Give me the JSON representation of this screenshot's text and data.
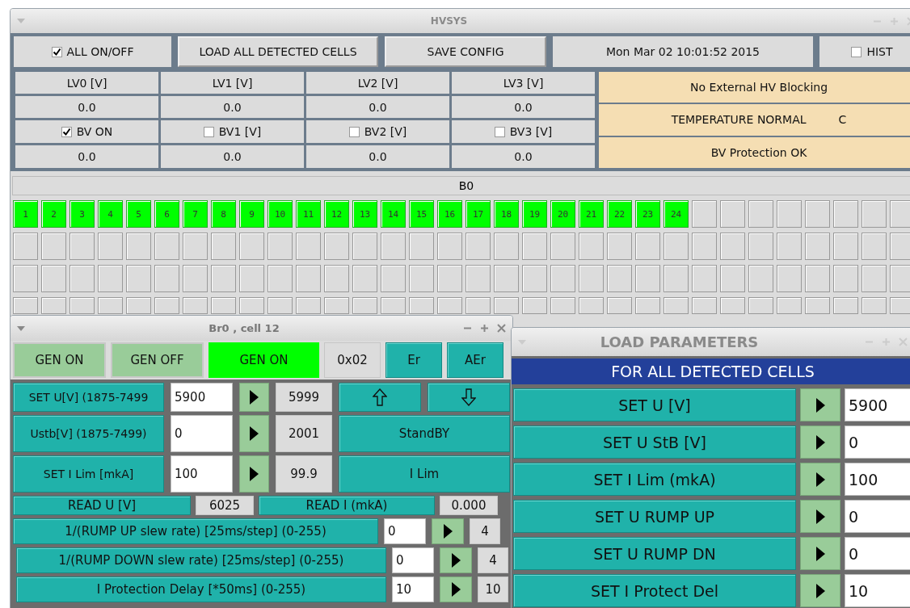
{
  "main_window": {
    "title": "HVSYS"
  },
  "toolbar": {
    "all_on_off": {
      "label": "ALL ON/OFF",
      "checked": true
    },
    "load_button": "LOAD ALL DETECTED CELLS",
    "save_button": "SAVE CONFIG",
    "datetime": "Mon Mar 02 10:01:52 2015",
    "hist": {
      "label": "HIST",
      "checked": false
    }
  },
  "lv_headers": [
    "LV0 [V]",
    "LV1 [V]",
    "LV2 [V]",
    "LV3 [V]"
  ],
  "lv_values": [
    "0.0",
    "0.0",
    "0.0",
    "0.0"
  ],
  "bv_toggles": [
    {
      "label": "BV ON",
      "checked": true
    },
    {
      "label": "BV1 [V]",
      "checked": false
    },
    {
      "label": "BV2 [V]",
      "checked": false
    },
    {
      "label": "BV3 [V]",
      "checked": false
    }
  ],
  "bv_values": [
    "0.0",
    "0.0",
    "0.0",
    "0.0"
  ],
  "status": [
    {
      "text": "No External HV Blocking"
    },
    {
      "text": "TEMPERATURE NORMAL",
      "unit": "C"
    },
    {
      "text": "BV Protection OK"
    }
  ],
  "board": {
    "label": "B0",
    "cell_rows": [
      [
        {
          "label": "1",
          "on": true
        },
        {
          "label": "2",
          "on": true
        },
        {
          "label": "3",
          "on": true
        },
        {
          "label": "4",
          "on": true
        },
        {
          "label": "5",
          "on": true
        },
        {
          "label": "6",
          "on": true
        },
        {
          "label": "7",
          "on": true
        },
        {
          "label": "8",
          "on": true
        },
        {
          "label": "9",
          "on": true
        },
        {
          "label": "10",
          "on": true
        },
        {
          "label": "11",
          "on": true
        },
        {
          "label": "12",
          "on": true
        },
        {
          "label": "13",
          "on": true
        },
        {
          "label": "14",
          "on": true
        },
        {
          "label": "15",
          "on": true
        },
        {
          "label": "16",
          "on": true
        },
        {
          "label": "17",
          "on": true
        },
        {
          "label": "18",
          "on": true
        },
        {
          "label": "19",
          "on": true
        },
        {
          "label": "20",
          "on": true
        },
        {
          "label": "21",
          "on": true
        },
        {
          "label": "22",
          "on": true
        },
        {
          "label": "23",
          "on": true
        },
        {
          "label": "24",
          "on": true
        },
        {
          "on": false
        },
        {
          "on": false
        },
        {
          "on": false
        },
        {
          "on": false
        },
        {
          "on": false
        },
        {
          "on": false
        },
        {
          "on": false
        },
        {
          "on": false
        }
      ],
      [
        {
          "on": false
        },
        {
          "on": false
        },
        {
          "on": false
        },
        {
          "on": false
        },
        {
          "on": false
        },
        {
          "on": false
        },
        {
          "on": false
        },
        {
          "on": false
        },
        {
          "on": false
        },
        {
          "on": false
        },
        {
          "on": false
        },
        {
          "on": false
        },
        {
          "on": false
        },
        {
          "on": false
        },
        {
          "on": false
        },
        {
          "on": false
        },
        {
          "on": false
        },
        {
          "on": false
        },
        {
          "on": false
        },
        {
          "on": false
        },
        {
          "on": false
        },
        {
          "on": false
        },
        {
          "on": false
        },
        {
          "on": false
        },
        {
          "on": false
        },
        {
          "on": false
        },
        {
          "on": false
        },
        {
          "on": false
        },
        {
          "on": false
        },
        {
          "on": false
        },
        {
          "on": false
        },
        {
          "on": false
        }
      ],
      [
        {
          "on": false
        },
        {
          "on": false
        },
        {
          "on": false
        },
        {
          "on": false
        },
        {
          "on": false
        },
        {
          "on": false
        },
        {
          "on": false
        },
        {
          "on": false
        },
        {
          "on": false
        },
        {
          "on": false
        },
        {
          "on": false
        },
        {
          "on": false
        },
        {
          "on": false
        },
        {
          "on": false
        },
        {
          "on": false
        },
        {
          "on": false
        },
        {
          "on": false
        },
        {
          "on": false
        },
        {
          "on": false
        },
        {
          "on": false
        },
        {
          "on": false
        },
        {
          "on": false
        },
        {
          "on": false
        },
        {
          "on": false
        },
        {
          "on": false
        },
        {
          "on": false
        },
        {
          "on": false
        },
        {
          "on": false
        },
        {
          "on": false
        },
        {
          "on": false
        },
        {
          "on": false
        },
        {
          "on": false
        }
      ],
      [
        {
          "on": false
        },
        {
          "on": false
        },
        {
          "on": false
        },
        {
          "on": false
        },
        {
          "on": false
        },
        {
          "on": false
        },
        {
          "on": false
        },
        {
          "on": false
        },
        {
          "on": false
        },
        {
          "on": false
        },
        {
          "on": false
        },
        {
          "on": false
        },
        {
          "on": false
        },
        {
          "on": false
        },
        {
          "on": false
        },
        {
          "on": false
        },
        {
          "on": false
        },
        {
          "on": false
        },
        {
          "on": false
        },
        {
          "on": false
        },
        {
          "on": false
        },
        {
          "on": false
        },
        {
          "on": false
        },
        {
          "on": false
        },
        {
          "on": false
        },
        {
          "on": false
        },
        {
          "on": false
        },
        {
          "on": false
        },
        {
          "on": false
        },
        {
          "on": false
        },
        {
          "on": false
        },
        {
          "on": false
        }
      ]
    ]
  },
  "cell_window": {
    "title": "Br0 , cell 12",
    "gen_controls": [
      {
        "label": "GEN ON",
        "kind": "button"
      },
      {
        "label": "GEN OFF",
        "kind": "button"
      },
      {
        "label": "GEN ON",
        "kind": "indicator"
      }
    ],
    "address": "0x02",
    "error_buttons": [
      "Er",
      "AEr"
    ],
    "settings": [
      {
        "label": "SET U[V] (1875-7499",
        "value": "5900",
        "reading": "5999",
        "action": {
          "kind": "arrows"
        }
      },
      {
        "label": "Ustb[V] (1875-7499)",
        "value": "0",
        "reading": "2001",
        "action": {
          "kind": "button",
          "label": "StandBY"
        }
      },
      {
        "label": "SET I Lim [mkA]",
        "value": "100",
        "reading": "99.9",
        "action": {
          "kind": "button",
          "label": "I Lim"
        }
      }
    ],
    "readouts": [
      {
        "label": "READ U [V]",
        "value": "6025"
      },
      {
        "label": "READ I (mkA)",
        "value": "0.000"
      }
    ],
    "slew_rows": [
      {
        "label": "1/(RUMP UP slew rate) [25ms/step] (0-255)",
        "value": "0",
        "reading": "4"
      },
      {
        "label": "1/(RUMP DOWN slew rate) [25ms/step] (0-255)",
        "value": "0",
        "reading": "4"
      },
      {
        "label": "I Protection Delay [*50ms] (0-255)",
        "value": "10",
        "reading": "10"
      }
    ]
  },
  "load_window": {
    "title": "LOAD PARAMETERS",
    "header": "FOR ALL DETECTED CELLS",
    "rows": [
      {
        "label": "SET U [V]",
        "value": "5900"
      },
      {
        "label": "SET U StB [V]",
        "value": "0"
      },
      {
        "label": "SET I Lim (mkA)",
        "value": "100"
      },
      {
        "label": "SET U RUMP UP",
        "value": "0"
      },
      {
        "label": "SET U RUMP DN",
        "value": "0"
      },
      {
        "label": "SET I Protect Del",
        "value": "10"
      }
    ]
  }
}
